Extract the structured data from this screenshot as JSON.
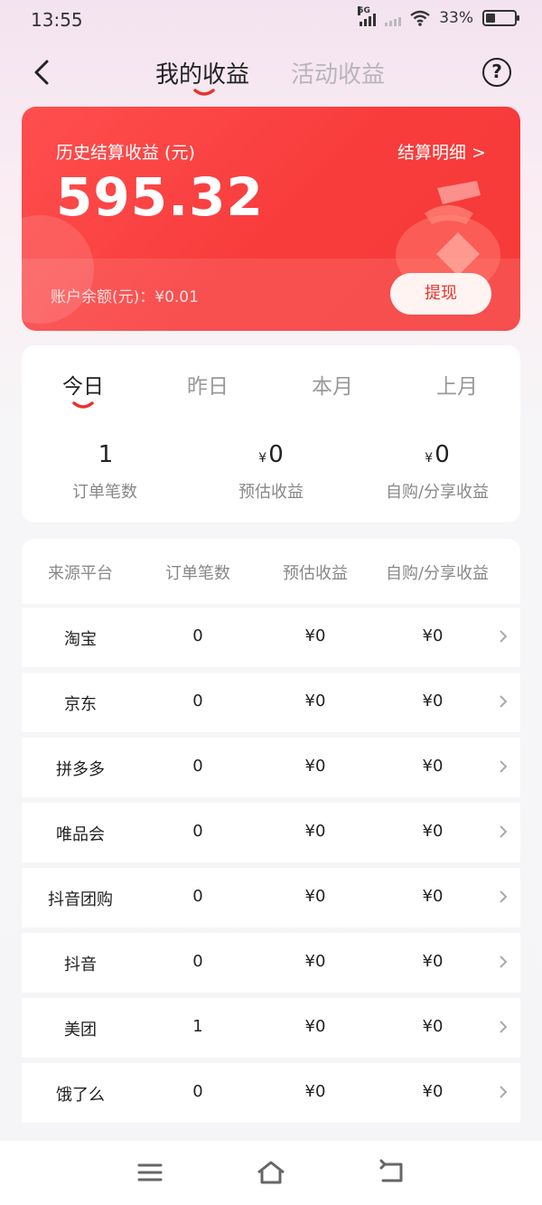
{
  "status_bar": {
    "time": "13:55",
    "network": "5G",
    "battery": "33%"
  },
  "header": {
    "tabs": [
      "我的收益",
      "活动收益"
    ],
    "active_tab": 0,
    "help_label": "?"
  },
  "earnings_card": {
    "label": "历史结算收益 (元)",
    "detail_link": "结算明细 >",
    "amount": "595.32",
    "balance": "账户余额(元)：¥0.01",
    "withdraw_label": "提现"
  },
  "period": {
    "tabs": [
      "今日",
      "昨日",
      "本月",
      "上月"
    ],
    "active": 0,
    "stats": [
      {
        "value": "1",
        "yen": "",
        "label": "订单笔数"
      },
      {
        "value": "0",
        "yen": "¥",
        "label": "预估收益"
      },
      {
        "value": "0",
        "yen": "¥",
        "label": "自购/分享收益"
      }
    ]
  },
  "table": {
    "headers": [
      "来源平台",
      "订单笔数",
      "预估收益",
      "自购/分享收益"
    ],
    "rows": [
      {
        "platform": "淘宝",
        "orders": "0",
        "estimated": "¥0",
        "self_share": "¥0"
      },
      {
        "platform": "京东",
        "orders": "0",
        "estimated": "¥0",
        "self_share": "¥0"
      },
      {
        "platform": "拼多多",
        "orders": "0",
        "estimated": "¥0",
        "self_share": "¥0"
      },
      {
        "platform": "唯品会",
        "orders": "0",
        "estimated": "¥0",
        "self_share": "¥0"
      },
      {
        "platform": "抖音团购",
        "orders": "0",
        "estimated": "¥0",
        "self_share": "¥0"
      },
      {
        "platform": "抖音",
        "orders": "0",
        "estimated": "¥0",
        "self_share": "¥0"
      },
      {
        "platform": "美团",
        "orders": "1",
        "estimated": "¥0",
        "self_share": "¥0"
      },
      {
        "platform": "饿了么",
        "orders": "0",
        "estimated": "¥0",
        "self_share": "¥0"
      }
    ]
  },
  "nav_bar": {
    "icons": [
      "menu-icon",
      "home-icon",
      "back-icon"
    ]
  },
  "colors": {
    "accent": "#f63a3a",
    "active_text": "#222222",
    "inactive_text": "#999999",
    "underline": "#e8342c"
  }
}
